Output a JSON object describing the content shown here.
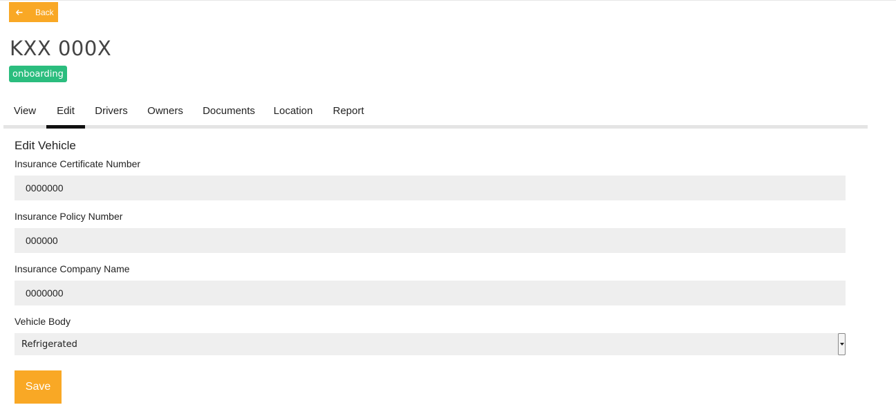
{
  "header": {
    "back_label": "Back",
    "vehicle_plate": "KXX 000X",
    "status_badge": "onboarding"
  },
  "tabs": [
    {
      "label": "View"
    },
    {
      "label": "Edit",
      "active": true
    },
    {
      "label": "Drivers"
    },
    {
      "label": "Owners"
    },
    {
      "label": "Documents"
    },
    {
      "label": "Location"
    },
    {
      "label": "Report"
    }
  ],
  "form": {
    "title": "Edit Vehicle",
    "fields": [
      {
        "label": "Insurance Certificate Number",
        "value": "0000000"
      },
      {
        "label": "Insurance Policy Number",
        "value": "000000"
      },
      {
        "label": "Insurance Company Name",
        "value": "0000000"
      }
    ],
    "vehicle_body": {
      "label": "Vehicle Body",
      "selected": "Refrigerated"
    },
    "save_label": "Save"
  },
  "colors": {
    "accent": "#f9a825",
    "badge": "#2bbd7e",
    "input_bg": "#eeeeee"
  }
}
